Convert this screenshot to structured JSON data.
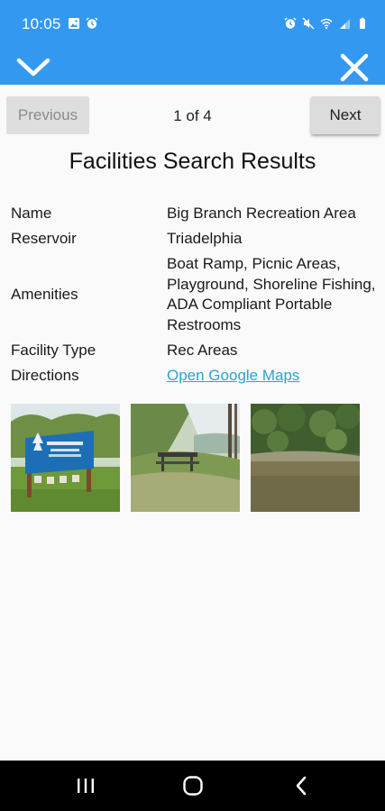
{
  "status_bar": {
    "time": "10:05",
    "left_icons": [
      "image-icon",
      "alarm-icon"
    ],
    "right_icons": [
      "alarm-icon",
      "mute-icon",
      "wifi-icon",
      "signal-icon",
      "battery-icon"
    ]
  },
  "toolbar": {
    "collapse_icon": "chevron-down-icon",
    "close_icon": "close-icon",
    "color": "#3399f0"
  },
  "pager": {
    "previous_label": "Previous",
    "next_label": "Next",
    "page_count": "1 of 4"
  },
  "page_title": "Facilities Search Results",
  "details": {
    "name_label": "Name",
    "name_value": "Big Branch Recreation Area",
    "reservoir_label": "Reservoir",
    "reservoir_value": "Triadelphia",
    "amenities_label": "Amenities",
    "amenities_value": "Boat Ramp, Picnic Areas, Playground, Shoreline Fishing, ADA Compliant Portable Restrooms",
    "facility_type_label": "Facility Type",
    "facility_type_value": "Rec Areas",
    "directions_label": "Directions",
    "directions_link": "Open Google Maps"
  },
  "photos": [
    {
      "subject": "entrance sign",
      "sign_text": "Big Branch Recreation Area"
    },
    {
      "subject": "picnic table by shoreline"
    },
    {
      "subject": "reservoir shoreline with trees"
    }
  ],
  "nav_bar": {
    "icons": [
      "recent-apps-icon",
      "home-icon",
      "back-icon"
    ]
  }
}
